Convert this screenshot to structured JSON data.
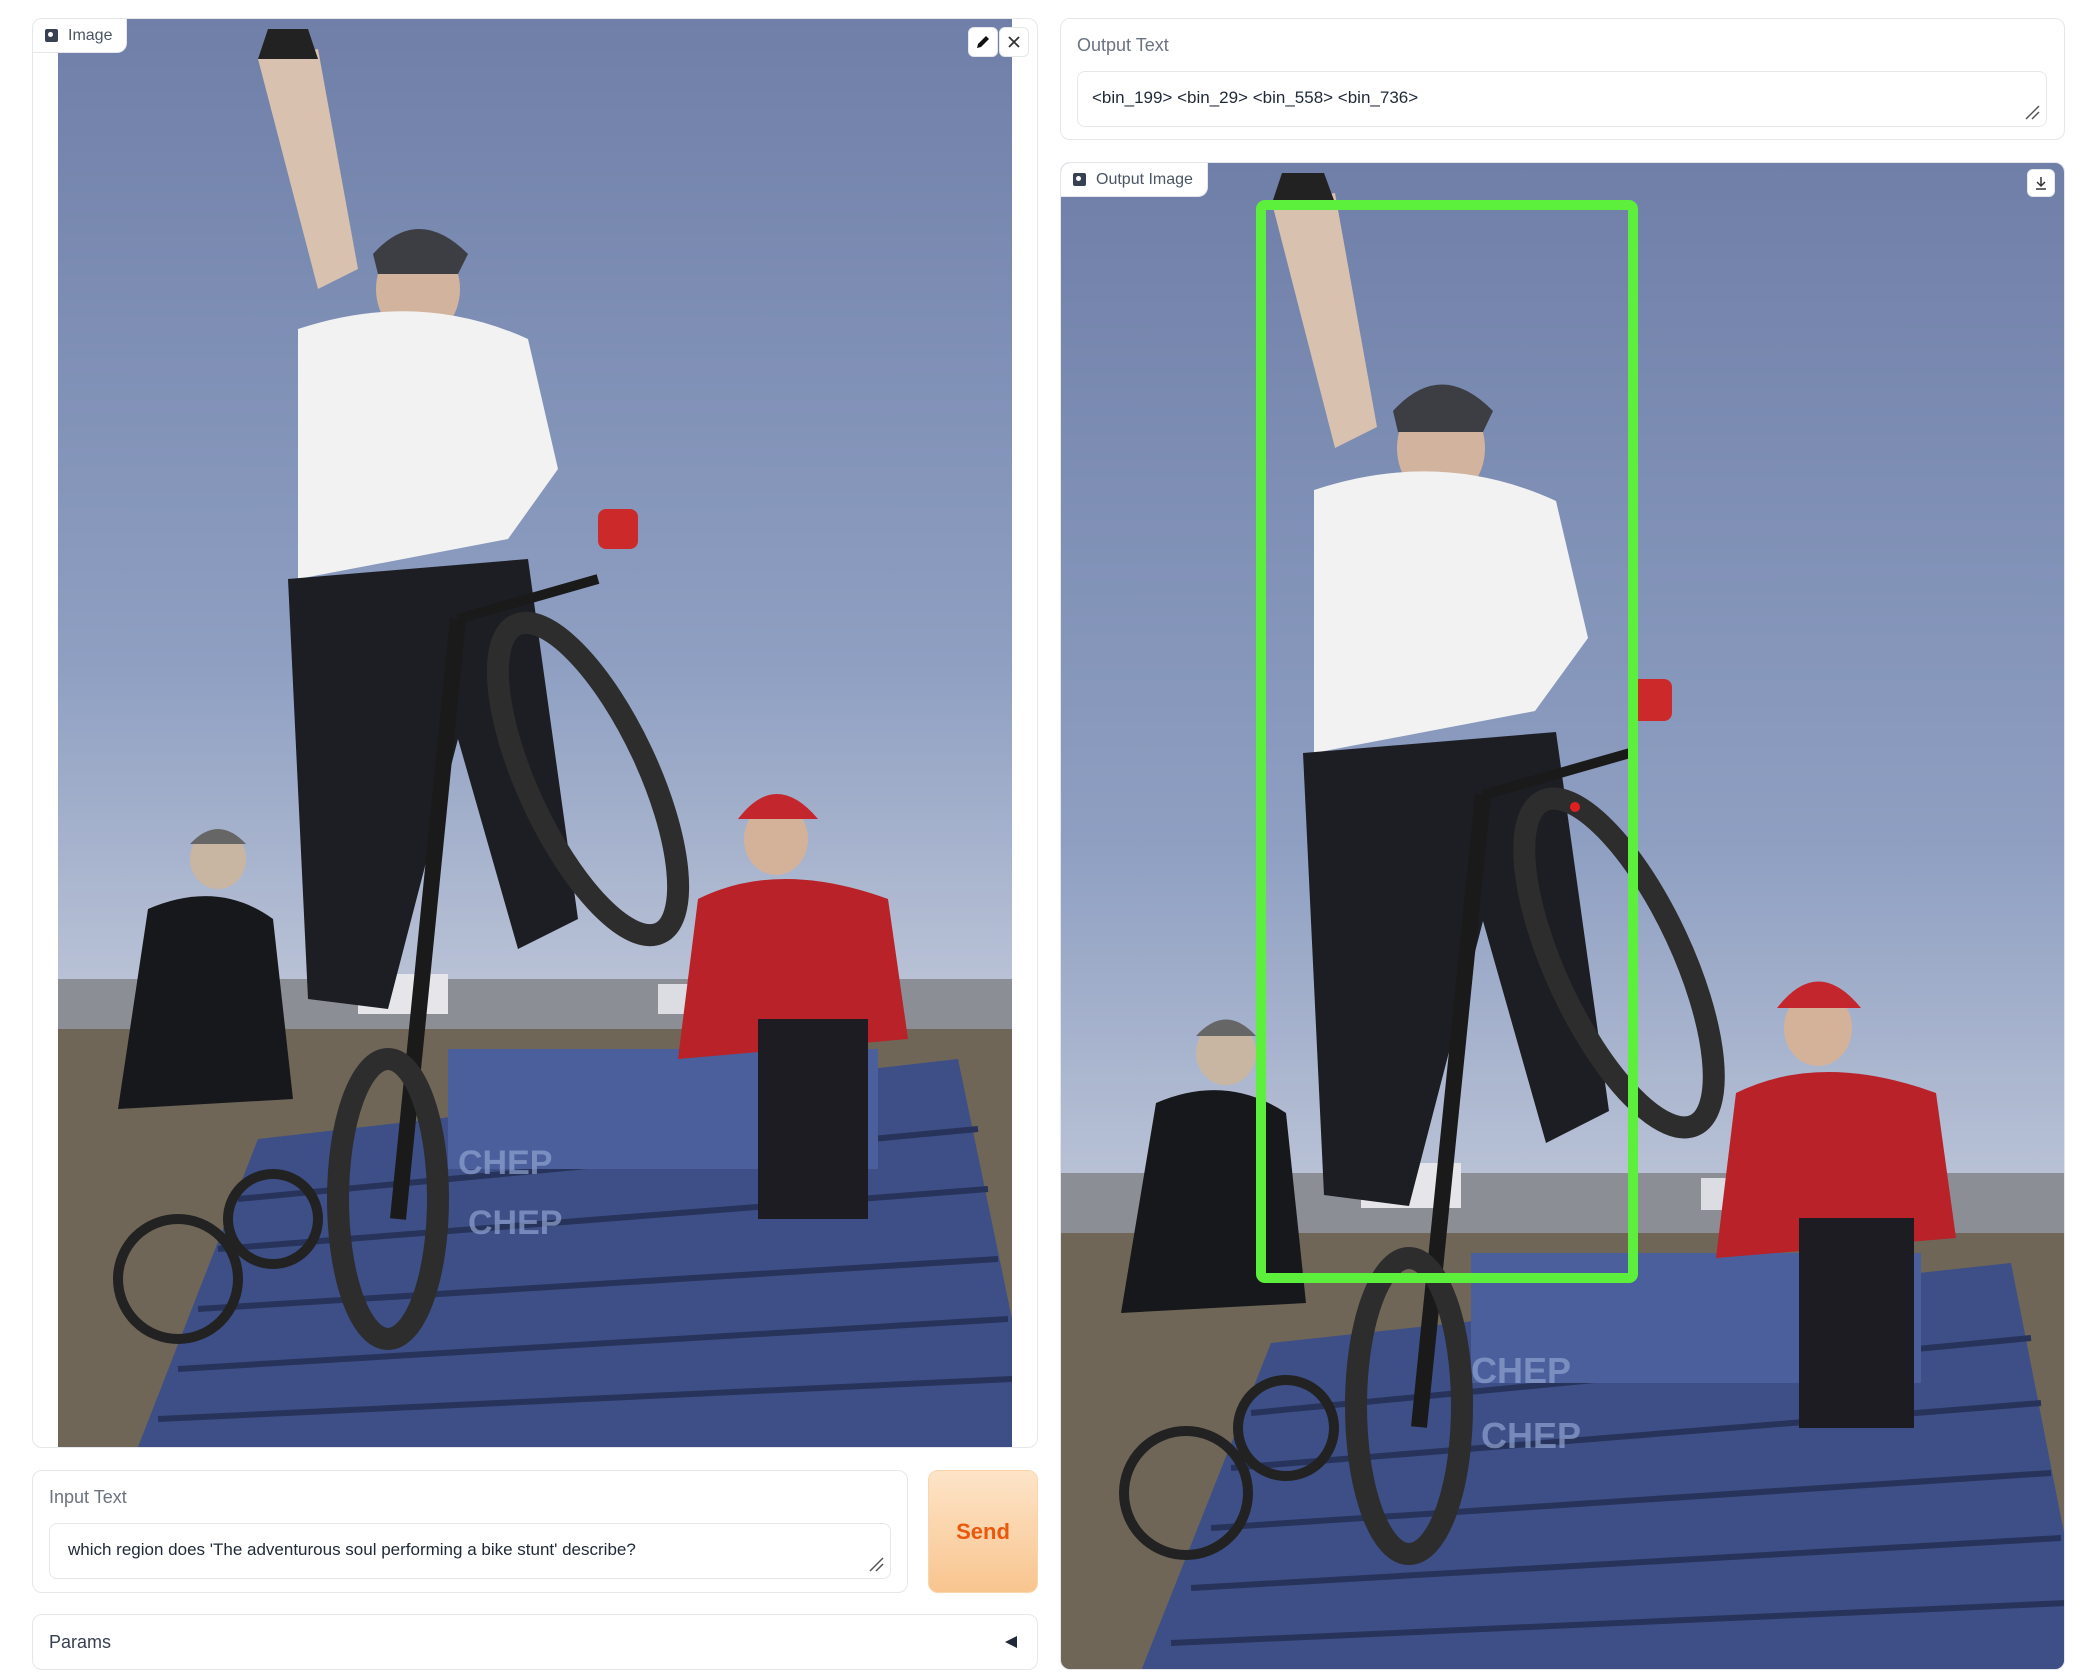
{
  "input_image": {
    "tag_label": "Image",
    "edit_icon": "pencil-icon",
    "clear_icon": "close-icon"
  },
  "output_text": {
    "label": "Output Text",
    "value": "<bin_199> <bin_29> <bin_558> <bin_736>"
  },
  "output_image": {
    "tag_label": "Output Image",
    "download_icon": "download-icon",
    "box_color": "#5cf03c",
    "point_color": "#e02020"
  },
  "input_text": {
    "label": "Input Text",
    "value": "which region does 'The adventurous soul performing a bike stunt' describe?"
  },
  "send": {
    "label": "Send"
  },
  "params": {
    "label": "Params",
    "toggle_icon": "triangle-left-icon"
  }
}
